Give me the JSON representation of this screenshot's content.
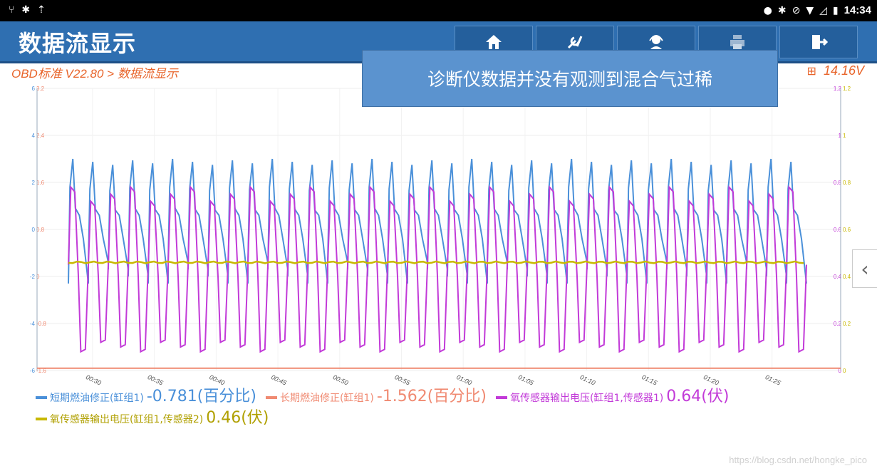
{
  "status_bar": {
    "left_icons": [
      "usb-icon",
      "bug-icon",
      "upload-icon"
    ],
    "right_icons": [
      "location-icon",
      "bluetooth-icon",
      "dnd-icon",
      "wifi-icon",
      "signal-icon",
      "battery-icon"
    ],
    "time": "14:34"
  },
  "header": {
    "title": "数据流显示",
    "nav": [
      {
        "name": "home",
        "icon": "home-icon"
      },
      {
        "name": "diagnose",
        "icon": "wrench-icon"
      },
      {
        "name": "support",
        "icon": "headset-icon"
      },
      {
        "name": "print",
        "icon": "printer-icon"
      },
      {
        "name": "exit",
        "icon": "exit-icon"
      }
    ]
  },
  "breadcrumb": "OBD标准 V22.80 > 数据流显示",
  "battery_voltage": "14.16V",
  "overlay_note": "诊断仪数据并没有观测到混合气过稀",
  "colors": {
    "blue": "#4a90d9",
    "salmon": "#f08a72",
    "purple": "#c23ad8",
    "yellow": "#c8b800",
    "header": "#2f6fb1",
    "accent": "#e8642a"
  },
  "chart_data": {
    "type": "line",
    "y_left_outer": {
      "ticks": [
        "6",
        "4",
        "2",
        "0",
        "-2",
        "-4",
        "-6"
      ],
      "range": [
        -6,
        6
      ]
    },
    "y_left_inner": {
      "ticks": [
        "3.2",
        "2.4",
        "1.6",
        "0.8",
        "0",
        "-0.8",
        "-1.6"
      ],
      "range": [
        -1.6,
        3.2
      ]
    },
    "y_right_inner": {
      "ticks": [
        "1.2",
        "1",
        "0.8",
        "0.6",
        "0.4",
        "0.2",
        "0"
      ],
      "range": [
        0,
        1.2
      ]
    },
    "y_right_outer": {
      "ticks": [
        "1.2",
        "1",
        "0.8",
        "0.6",
        "0.4",
        "0.2",
        "0"
      ],
      "range": [
        0,
        1.2
      ]
    },
    "x_ticks": [
      "00:30",
      "00:35",
      "00:40",
      "00:45",
      "00:50",
      "00:55",
      "01:00",
      "01:05",
      "01:10",
      "01:15",
      "01:20",
      "01:25"
    ],
    "series": [
      {
        "name": "短期燃油修正(缸组1)",
        "value": "-0.781(百分比)",
        "color": "#4a90d9",
        "axis": "left_outer",
        "pattern": "sawtooth",
        "min": -2.3,
        "max": 3.0,
        "cycles": 37
      },
      {
        "name": "长期燃油修正(缸组1)",
        "value": "-1.562(百分比)",
        "color": "#f08a72",
        "axis": "left_inner",
        "pattern": "flat",
        "level": -1.56
      },
      {
        "name": "氧传感器输出电压(缸组1,传感器1)",
        "value": "0.64(伏)",
        "color": "#c23ad8",
        "axis": "right",
        "pattern": "oscillation",
        "min": 0.08,
        "max": 0.78,
        "cycles": 37
      },
      {
        "name": "氧传感器输出电压(缸组1,传感器2)",
        "value": "0.46(伏)",
        "color": "#c8b800",
        "axis": "right",
        "pattern": "flat",
        "level": 0.46
      }
    ]
  },
  "side_tab_icon": "chevron-left-icon",
  "watermark": "https://blog.csdn.net/hongke_pico"
}
